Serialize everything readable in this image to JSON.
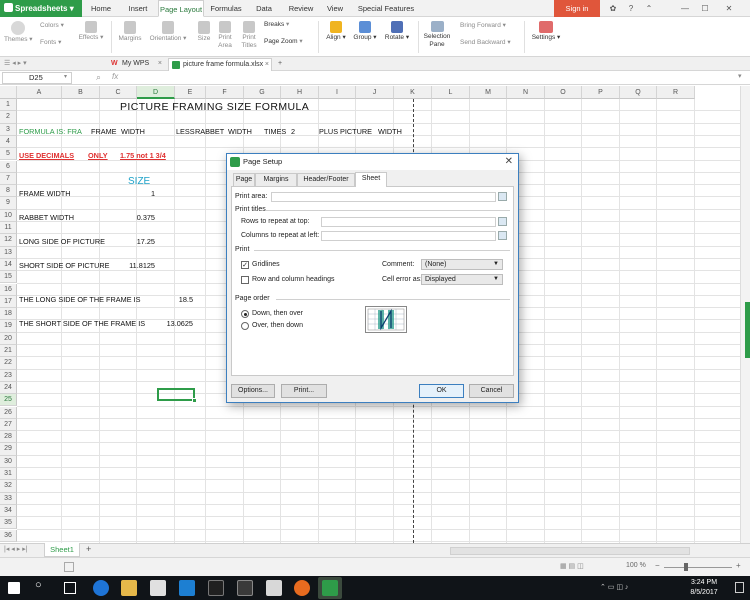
{
  "app": {
    "name": "Spreadsheets",
    "brand_color": "#2e9c49",
    "sign_in": "Sign in"
  },
  "menu": [
    "Home",
    "Insert",
    "Page Layout",
    "Formulas",
    "Data",
    "Review",
    "View",
    "Special Features"
  ],
  "menu_active": "Page Layout",
  "ribbon": {
    "themes": "Themes",
    "colors": "Colors",
    "fonts": "Fonts",
    "effects": "Effects",
    "margins": "Margins",
    "orientation": "Orientation",
    "size": "Size",
    "print_area": "Print Area",
    "print_titles": "Print Titles",
    "breaks": "Breaks",
    "page_zoom": "Page Zoom",
    "align": "Align",
    "group": "Group",
    "rotate": "Rotate",
    "selection_pane": "Selection Pane",
    "bring_forward": "Bring Forward",
    "send_backward": "Send Backward",
    "settings": "Settings"
  },
  "doc_tabs": {
    "my_wps": "My WPS",
    "file": "picture frame formula.xlsx"
  },
  "formula_bar": {
    "cell_ref": "D25",
    "fx": "fx",
    "value": ""
  },
  "columns": [
    "A",
    "B",
    "C",
    "D",
    "E",
    "F",
    "G",
    "H",
    "I",
    "J",
    "K",
    "L",
    "M",
    "N",
    "O",
    "P",
    "Q",
    "R"
  ],
  "selected_column": "D",
  "selected_row": "25",
  "rows": [
    "1",
    "2",
    "3",
    "4",
    "5",
    "6",
    "7",
    "8",
    "9",
    "10",
    "11",
    "12",
    "13",
    "14",
    "15",
    "16",
    "17",
    "18",
    "19",
    "20",
    "21",
    "22",
    "23",
    "24",
    "25",
    "26",
    "27",
    "28",
    "29",
    "30",
    "31",
    "32",
    "33",
    "34",
    "35",
    "36"
  ],
  "cells": {
    "title": "PICTURE  FRAMING  SIZE  FORMULA",
    "formula_is": "FORMULA IS:  FRA",
    "frame": "FRAME",
    "width1": "WIDTH",
    "less": "LESS",
    "rabbet": "RABBET",
    "width2": "WIDTH",
    "times": "TIMES",
    "two": "2",
    "plus": "PLUS",
    "picture": "PICTURE",
    "width3": "WIDTH",
    "use_decimals": "USE DECIMALS",
    "only": "ONLY",
    "example": "1.75  not 1 3/4",
    "size": "SIZE",
    "frame_width_label": "FRAME WIDTH",
    "frame_width_value": "1",
    "rabbet_width_label": "RABBET WIDTH",
    "rabbet_width_value": "0.375",
    "long_side_label": "LONG SIDE OF PICTURE",
    "long_side_value": "17.25",
    "short_side_label": "SHORT SIDE OF PICTURE",
    "short_side_value": "11.8125",
    "long_frame_label": "THE LONG SIDE OF THE FRAME IS",
    "long_frame_value": "18.5",
    "short_frame_label": "THE SHORT SIDE OF THE FRAME IS",
    "short_frame_value": "13.0625"
  },
  "dialog": {
    "title": "Page Setup",
    "tabs": [
      "Page",
      "Margins",
      "Header/Footer",
      "Sheet"
    ],
    "active_tab": "Sheet",
    "print_area": "Print area:",
    "print_titles": "Print titles",
    "rows_repeat": "Rows to repeat at top:",
    "cols_repeat": "Columns to repeat at left:",
    "print": "Print",
    "gridlines": "Gridlines",
    "gridlines_checked": true,
    "row_col_headings": "Row and column headings",
    "row_col_headings_checked": false,
    "comment_label": "Comment:",
    "comment_value": "(None)",
    "cell_error_label": "Cell error as:",
    "cell_error_value": "Displayed",
    "page_order": "Page order",
    "down_then_over": "Down, then over",
    "over_then_down": "Over, then down",
    "selected_order": "Down, then over",
    "options_btn": "Options...",
    "print_btn": "Print...",
    "ok_btn": "OK",
    "cancel_btn": "Cancel"
  },
  "sheet_tabs": [
    "Sheet1"
  ],
  "status": {
    "zoom": "100 %"
  },
  "clock": {
    "time": "3:24 PM",
    "date": "8/5/2017"
  }
}
